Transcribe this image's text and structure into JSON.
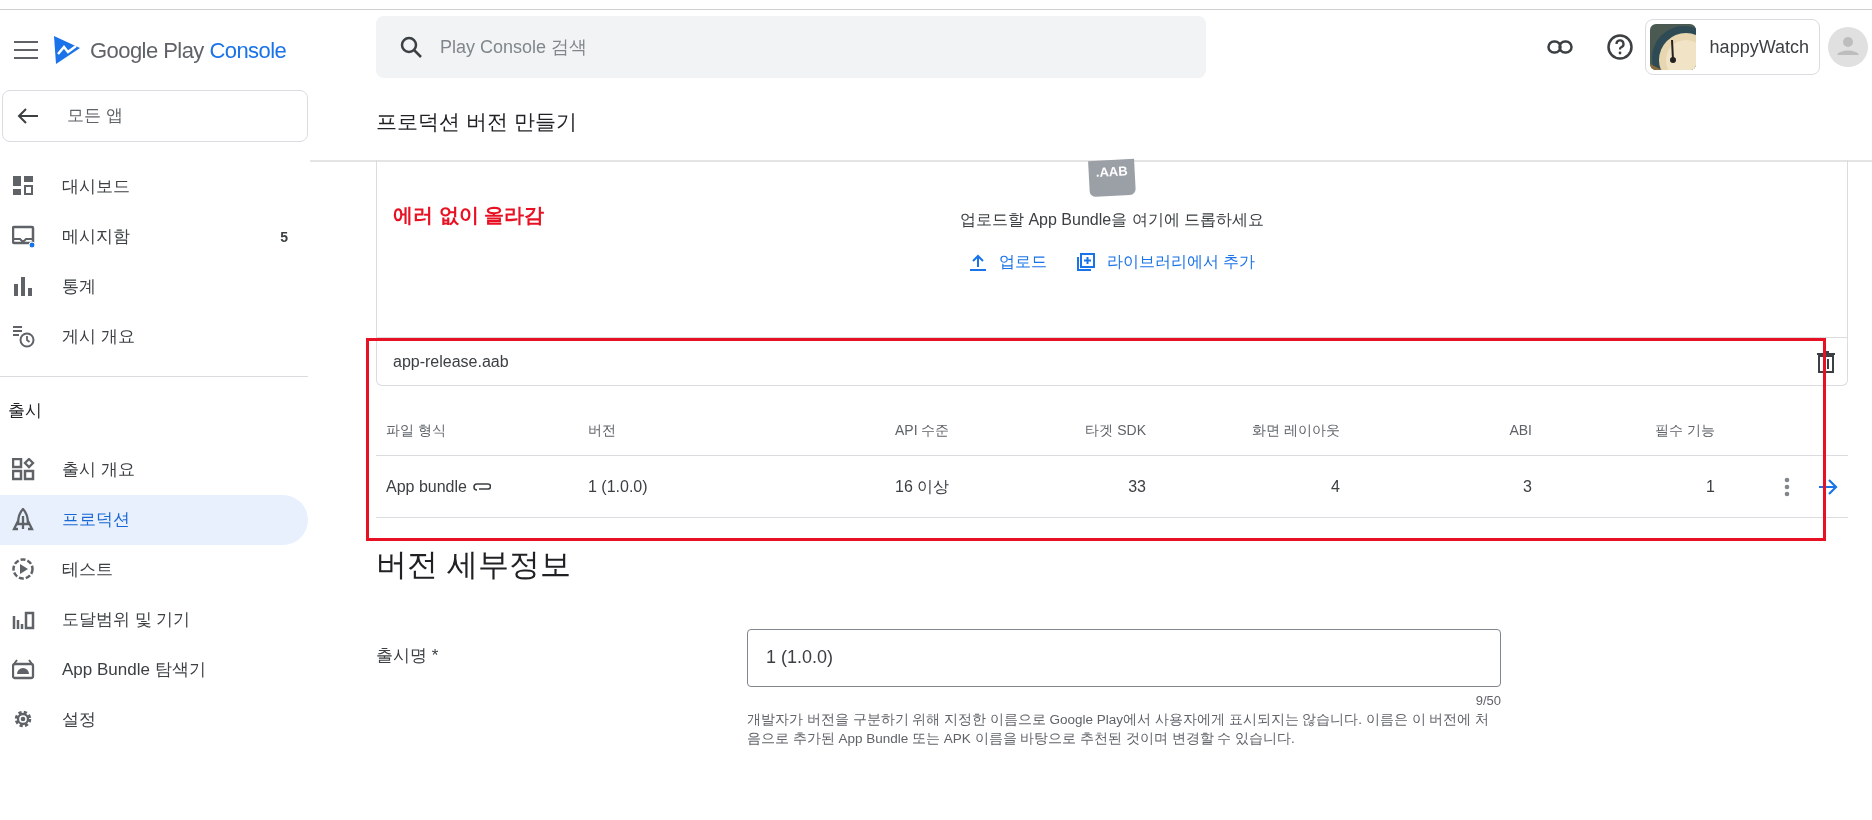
{
  "header": {
    "brand": "Google Play",
    "product": "Console",
    "search": {
      "placeholder": "Play Console 검색"
    },
    "account": {
      "name": "happyWatch"
    }
  },
  "page_title": "프로덕션 버전 만들기",
  "sidebar": {
    "back": "모든 앱",
    "groups": [
      {
        "items": [
          {
            "label": "대시보드",
            "kind": "dashboard",
            "selected": false
          },
          {
            "label": "메시지함",
            "kind": "inbox",
            "selected": false,
            "badge": "5",
            "unread": true
          },
          {
            "label": "통계",
            "kind": "stats",
            "selected": false
          },
          {
            "label": "게시 개요",
            "kind": "publishing",
            "selected": false
          }
        ]
      },
      {
        "heading": "출시",
        "items": [
          {
            "label": "출시 개요",
            "kind": "overview",
            "selected": false
          },
          {
            "label": "프로덕션",
            "kind": "production",
            "selected": true
          },
          {
            "label": "테스트",
            "kind": "testing",
            "selected": false
          },
          {
            "label": "도달범위 및 기기",
            "kind": "reach",
            "selected": false
          },
          {
            "label": "App Bundle 탐색기",
            "kind": "bundle",
            "selected": false
          },
          {
            "label": "설정",
            "kind": "settings",
            "selected": false
          }
        ]
      }
    ]
  },
  "annotation": {
    "text": "에러 없이 올라감"
  },
  "upload": {
    "file_badge": ".AAB",
    "prompt": "업로드할 App Bundle을 여기에 드롭하세요",
    "actions": [
      {
        "label": "업로드",
        "kind": "upload"
      },
      {
        "label": "라이브러리에서 추가",
        "kind": "library"
      }
    ]
  },
  "file": {
    "name": "app-release.aab"
  },
  "table": {
    "columns": [
      "파일 형식",
      "버전",
      "API 수준",
      "타겟 SDK",
      "화면 레이아웃",
      "ABI",
      "필수 기능"
    ],
    "rows": [
      {
        "cells": [
          "App bundle",
          "1 (1.0.0)",
          "16 이상",
          "33",
          "4",
          "3",
          "1"
        ]
      }
    ]
  },
  "release_details": {
    "heading": "버전 세부정보",
    "name_label": "출시명 *",
    "name_value": "1 (1.0.0)",
    "counter": "9/50",
    "help": "개발자가 버전을 구분하기 위해 지정한 이름으로 Google Play에서 사용자에게 표시되지는 않습니다. 이름은 이 버전에 처음으로 추가된 App Bundle 또는 APK 이름을 바탕으로 추천된 것이며 변경할 수 있습니다."
  }
}
